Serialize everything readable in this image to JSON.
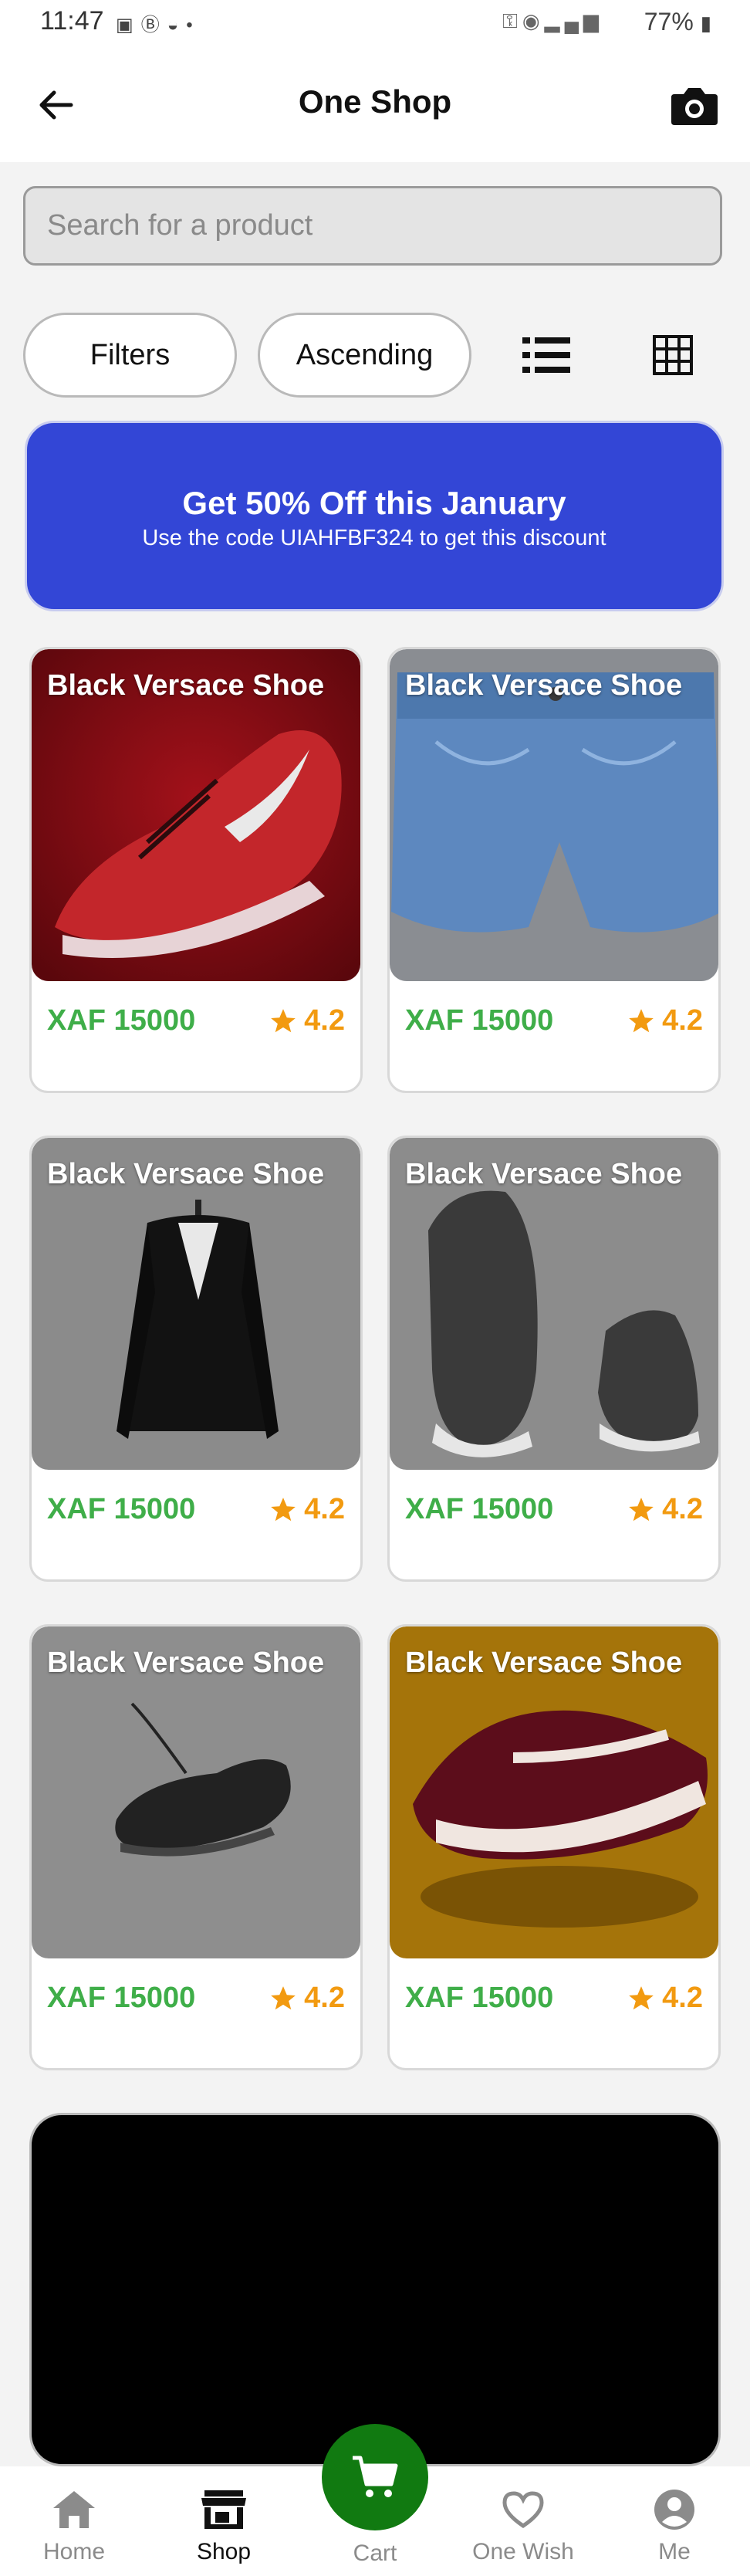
{
  "status_bar": {
    "time": "11:47",
    "battery": "77%"
  },
  "app_bar": {
    "title": "One Shop",
    "back_icon": "arrow-left-icon",
    "camera_icon": "camera-icon"
  },
  "search": {
    "placeholder": "Search for a product",
    "value": ""
  },
  "controls": {
    "filters_label": "Filters",
    "sort_label": "Ascending",
    "list_view_icon": "list-icon",
    "grid_view_icon": "grid-icon"
  },
  "banner": {
    "title": "Get 50% Off this January",
    "subtitle": "Use the code UIAHFBF324 to get this discount",
    "color": "#3346d6"
  },
  "products": [
    {
      "name": "Black Versace Shoe",
      "price": "XAF 15000",
      "rating": "4.2",
      "image": "red-sneaker"
    },
    {
      "name": "Black Versace Shoe",
      "price": "XAF 15000",
      "rating": "4.2",
      "image": "denim-shorts"
    },
    {
      "name": "Black Versace Shoe",
      "price": "XAF 15000",
      "rating": "4.2",
      "image": "black-blazer"
    },
    {
      "name": "Black Versace Shoe",
      "price": "XAF 15000",
      "rating": "4.2",
      "image": "grey-sneakers"
    },
    {
      "name": "Black Versace Shoe",
      "price": "XAF 15000",
      "rating": "4.2",
      "image": "black-sneaker"
    },
    {
      "name": "Black Versace Shoe",
      "price": "XAF 15000",
      "rating": "4.2",
      "image": "maroon-vans"
    }
  ],
  "colors": {
    "price": "#3fae49",
    "rating": "#f29a10",
    "cart_fab": "#117a11"
  },
  "bottom_nav": {
    "items": [
      {
        "label": "Home",
        "icon": "home-icon",
        "active": false
      },
      {
        "label": "Shop",
        "icon": "shop-icon",
        "active": true
      },
      {
        "label": "Cart",
        "icon": "cart-icon",
        "active": false
      },
      {
        "label": "One Wish",
        "icon": "heart-icon",
        "active": false
      },
      {
        "label": "Me",
        "icon": "account-icon",
        "active": false
      }
    ]
  }
}
